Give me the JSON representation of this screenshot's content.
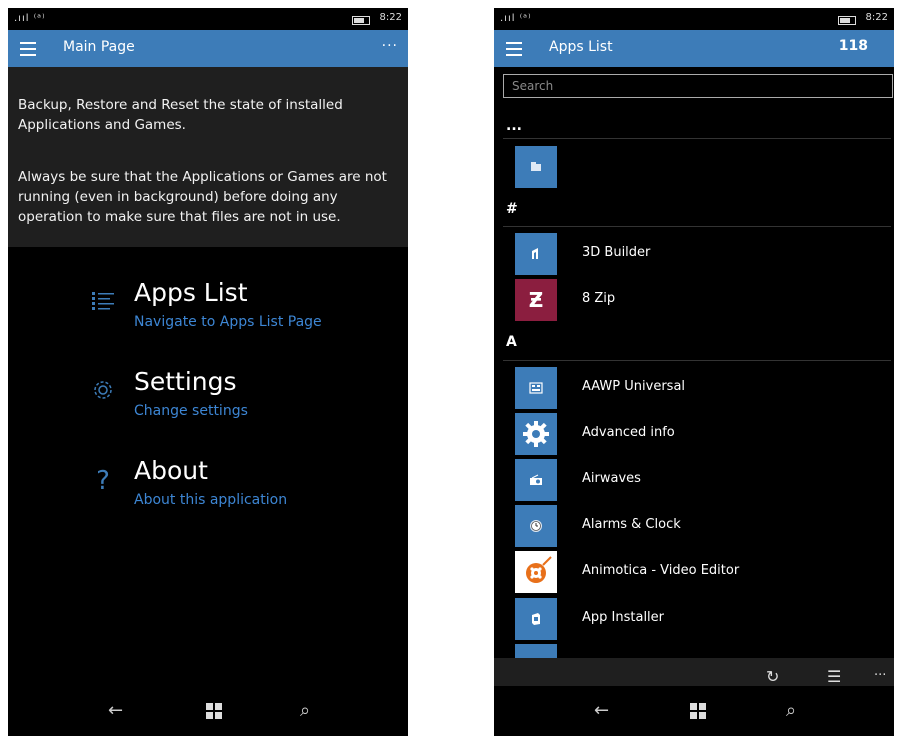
{
  "left": {
    "status": {
      "signal": ".ııl ⁽ᵃ⁾",
      "time": "8:22"
    },
    "header": {
      "title": "Main Page",
      "more": "···"
    },
    "info": {
      "p1": "Backup, Restore and Reset the state of installed Applications and Games.",
      "p2": "Always be sure that the Applications or Games are not running (even in background) before doing any operation to make sure that files are not in use."
    },
    "menu": [
      {
        "title": "Apps List",
        "subtitle": "Navigate to Apps List Page",
        "icon": "list-icon"
      },
      {
        "title": "Settings",
        "subtitle": "Change settings",
        "icon": "gear-icon"
      },
      {
        "title": "About",
        "subtitle": "About this application",
        "icon": "question-icon"
      }
    ],
    "navbar": {
      "back": "←",
      "search": "⌕"
    }
  },
  "right": {
    "status": {
      "signal": ".ııl ⁽ᵃ⁾",
      "time": "8:22"
    },
    "header": {
      "title": "Apps List",
      "count": "118"
    },
    "search": {
      "placeholder": "Search"
    },
    "groups": [
      {
        "label": "..."
      },
      {
        "label": "#"
      },
      {
        "label": "A"
      }
    ],
    "apps": [
      {
        "name": "",
        "color": "#3d7cb8",
        "icon": "app-tile-icon"
      },
      {
        "name": "3D Builder",
        "color": "#3d7cb8",
        "icon": "3d-builder-icon"
      },
      {
        "name": "8 Zip",
        "color": "#8b1e3f",
        "icon": "8zip-icon"
      },
      {
        "name": "AAWP Universal",
        "color": "#3d7cb8",
        "icon": "aawp-icon"
      },
      {
        "name": "Advanced info",
        "color": "#3d7cb8",
        "icon": "gear-icon"
      },
      {
        "name": "Airwaves",
        "color": "#3d7cb8",
        "icon": "radio-icon"
      },
      {
        "name": "Alarms & Clock",
        "color": "#3d7cb8",
        "icon": "clock-icon"
      },
      {
        "name": "Animotica - Video Editor",
        "color": "#ffffff",
        "icon": "film-reel-icon"
      },
      {
        "name": "App Installer",
        "color": "#3d7cb8",
        "icon": "installer-icon"
      }
    ],
    "appbar": {
      "refresh": "↻",
      "select": "☰",
      "more": "···"
    },
    "navbar": {
      "back": "←",
      "search": "⌕"
    }
  }
}
